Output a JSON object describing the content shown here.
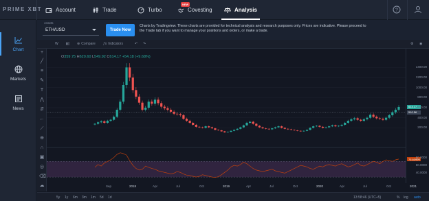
{
  "brand": {
    "logo_text": "PRIME XBT"
  },
  "nav": {
    "items": [
      {
        "label": "Account",
        "icon": "wallet-icon"
      },
      {
        "label": "Trade",
        "icon": "candles-icon"
      },
      {
        "label": "Turbo",
        "icon": "gauge-icon"
      },
      {
        "label": "Covesting",
        "icon": "handshake-icon",
        "badge": "NEW"
      },
      {
        "label": "Analysis",
        "icon": "scales-icon",
        "active": true
      }
    ]
  },
  "sidebar": {
    "items": [
      {
        "label": "Chart",
        "icon": "chart-icon",
        "active": true
      },
      {
        "label": "Markets",
        "icon": "globe-icon"
      },
      {
        "label": "News",
        "icon": "newspaper-icon"
      }
    ]
  },
  "asset": {
    "label": "Assets",
    "value": "ETH/USD"
  },
  "trade_button": {
    "label": "Trade Now"
  },
  "disclaimer": "Charts by Tradingview. These charts are provided for technical analysis and research purposes only. Prices are indicative. Please proceed to the Trade tab if you want to manage your positions and orders, or make a trade.",
  "chart_toolbar": {
    "interval": "W",
    "compare": "Compare",
    "indicators": "Indicators"
  },
  "ohlc": {
    "o_label": "O",
    "o": "359.75",
    "h_label": "H",
    "h": "620.60",
    "l_label": "L",
    "l": "549.92",
    "c_label": "C",
    "c": "614.17",
    "change": "+54.18 (+9.68%)"
  },
  "price_tags": {
    "last": "614.17",
    "ref": "510.56",
    "rsi": "75.60999"
  },
  "time_bar": {
    "ranges": [
      "5y",
      "1y",
      "6m",
      "3m",
      "1m",
      "5d",
      "1d"
    ],
    "clock": "13:58:46 (UTC+5)",
    "scale_opts": [
      "%",
      "log",
      "auto"
    ]
  },
  "colors": {
    "accent": "#2a8ff0",
    "up": "#26a69a",
    "down": "#ef5350",
    "rsi": "#c2410c",
    "rsi_band": "#3b2a4a"
  },
  "chart_data": {
    "type": "candlestick",
    "series": [
      {
        "name": "ETH/USD",
        "values": [
          280,
          310,
          330,
          300,
          340,
          360,
          420,
          560,
          720,
          1050,
          1400,
          1200,
          950,
          820,
          700,
          560,
          600,
          720,
          680,
          760,
          690,
          620,
          590,
          560,
          520,
          480,
          470,
          450,
          380,
          340,
          300,
          260,
          220,
          210,
          200,
          230,
          210,
          190,
          160,
          150,
          130,
          110,
          120,
          140,
          160,
          180,
          210,
          250,
          300,
          320,
          280,
          240,
          210,
          190,
          180,
          170,
          190,
          210,
          230,
          200,
          180,
          170,
          160,
          150,
          140,
          130,
          140,
          160,
          200,
          230,
          240,
          220,
          200,
          210,
          230,
          250,
          230,
          240,
          260,
          300,
          340,
          370,
          390,
          360,
          340,
          370,
          400,
          460,
          420,
          390,
          380,
          360,
          400,
          450,
          510,
          560,
          614
        ]
      }
    ],
    "x_ticks": [
      "Sep",
      "2018",
      "Apr",
      "Jul",
      "Oct",
      "2019",
      "Apr",
      "Jul",
      "Oct",
      "2020",
      "Apr",
      "Jul",
      "Oct",
      "2021"
    ],
    "y_ticks": [
      "1400.00",
      "1200.00",
      "1000.00",
      "800.00",
      "600.00",
      "400.00",
      "200.00"
    ],
    "ylim": [
      0,
      1500
    ],
    "rsi": {
      "name": "RSI",
      "y_ticks": [
        "80.0000",
        "60.0000",
        "40.0000"
      ],
      "ylim": [
        25,
        95
      ],
      "values": [
        55,
        62,
        58,
        66,
        70,
        74,
        80,
        88,
        92,
        90,
        86,
        72,
        60,
        52,
        48,
        50,
        58,
        55,
        52,
        50,
        46,
        44,
        42,
        40,
        38,
        40,
        44,
        42,
        38,
        35,
        34,
        32,
        30,
        32,
        36,
        34,
        32,
        30,
        29,
        31,
        36,
        42,
        48,
        56,
        60,
        58,
        62,
        68,
        64,
        58,
        52,
        48,
        46,
        44,
        46,
        48,
        50,
        46,
        44,
        42,
        40,
        44,
        48,
        52,
        56,
        60,
        58,
        56,
        52,
        50,
        54,
        58,
        56,
        60,
        62,
        60,
        58,
        62,
        64,
        60,
        56,
        58,
        62,
        66,
        60,
        58,
        62,
        66,
        70,
        68,
        64,
        70,
        74,
        72,
        70,
        74,
        76
      ]
    }
  }
}
